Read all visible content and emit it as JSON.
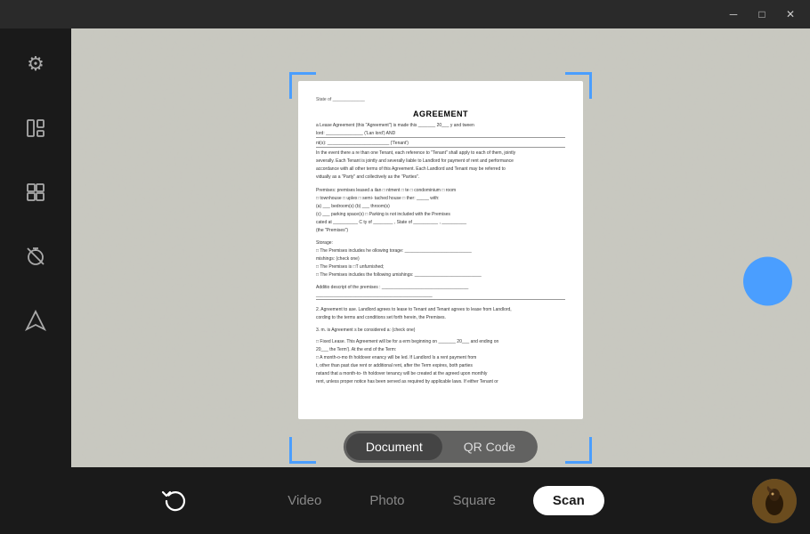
{
  "titlebar": {
    "minimize_label": "─",
    "maximize_label": "□",
    "close_label": "✕"
  },
  "sidebar": {
    "icons": [
      {
        "name": "settings-icon",
        "symbol": "⚙"
      },
      {
        "name": "layout-icon",
        "symbol": "⊞"
      },
      {
        "name": "grid-icon",
        "symbol": "⊟"
      },
      {
        "name": "timer-off-icon",
        "symbol": "⊘"
      },
      {
        "name": "navigation-icon",
        "symbol": "◈"
      }
    ]
  },
  "document": {
    "state_line": "State of _____________",
    "title": "AGREEMENT",
    "lines": [
      "a Lease Agreement (this \"Agreement\") is made this _______ 20___ y and tween",
      "lord: _______________ ('Lan lord') AND",
      "nt(s): _________________________ ('Tenant')",
      "In the event there a   re  than one Tenant, each reference to \"Tenant\" shall apply to each of them, jointly",
      "severally. Each Tenant is jointly and severally liable to Landlord for payment of rent and performance",
      "accordance with all other terms of this Agreement. Each Landlord and Tenant may be referred to",
      "vidually as a \"Party\" and collectively as the \"Parties\".",
      "",
      "Premises:    premises leased a ilan  □  ntment  □  te  □ condominium  □ room",
      "□ townhouse  □ uplex  □ semi-  tached house  □  ther: _____ with:",
      "(a) ___ bedroom(s)",
      "(b) ___ throom(s)",
      "(c) ___ parking space(s)  □ Parking is not included with the",
      "    Premises",
      "cated at _____________ C ty of __________ , State of __________ , __________",
      "(the \"Premises\")",
      "",
      "Storage:",
      "□ The Premises includes he ollowing torage: ___________________________ ,",
      "",
      "mishings: (check one)",
      "□ The Premises is  □T  unfurnished;",
      "□ The Premises includes the following  umishings: ___________________________",
      "",
      "Additio   descript  of the premises  :  ___________________________________",
      "_______________________________________________",
      "",
      "2. Agreement to    ase. Landlord agrees to lease to Tenant and Tenant agrees to lease from Landlord,",
      "cording to the terms and conditions set forth herein, the Premises.",
      "",
      "3.  m.  is Agreement s  be considered a: (check one)",
      "",
      "□ Fixed Lease. This Agreement will be for a  erm beginning on _________ 20___ and ending on",
      "20___  the  Term'). At the end of the Term:",
      "□ A month-o-mo  th holdover  enancy will be   led.  If Landlord    Is a rent payment from",
      "t, other than past due rent or additional rent, after the Term expires, both parties",
      "nstand that a month-to-   th holdover tenancy will be created at the agreed upon monthly",
      "rent, unless proper notice has been served as required by applicable laws. If either Tenant or"
    ]
  },
  "scan_modes": {
    "tabs": [
      {
        "label": "Document",
        "active": true
      },
      {
        "label": "QR Code",
        "active": false
      }
    ]
  },
  "bottom_bar": {
    "modes": [
      {
        "label": "Video",
        "active": false
      },
      {
        "label": "Photo",
        "active": false
      },
      {
        "label": "Square",
        "active": false
      },
      {
        "label": "Scan",
        "active": true
      }
    ]
  },
  "colors": {
    "accent_blue": "#4a9eff",
    "bg_dark": "#1a1a1a",
    "camera_bg": "#c8c8c0",
    "tab_bg": "rgba(80,80,80,0.85)"
  }
}
